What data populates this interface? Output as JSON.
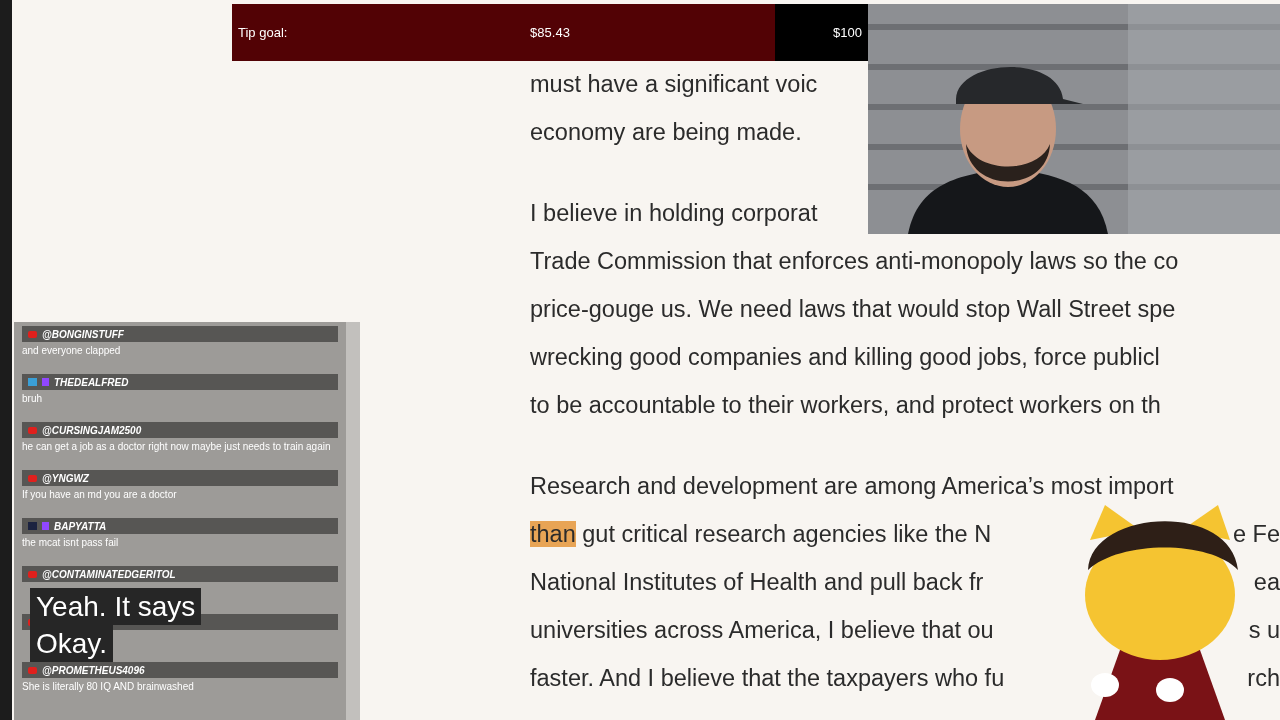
{
  "tip_goal": {
    "label": "Tip goal:",
    "current": "$85.43",
    "target": "$100",
    "level": 0.8543
  },
  "article": {
    "paragraphs": [
      {
        "lines": [
          {
            "text": "must have a significant voic"
          },
          {
            "text": "economy are being made."
          }
        ]
      },
      {
        "lines": [
          {
            "text": "I believe in holding corporat"
          },
          {
            "text": "Trade Commission that enforces anti-monopoly laws so the co"
          },
          {
            "text": "price-gouge us. We need laws that would stop Wall Street spe"
          },
          {
            "text": "wrecking good companies and killing good jobs, force publicl"
          },
          {
            "text": "to be accountable to their workers, and protect workers on th"
          }
        ]
      },
      {
        "lines": [
          {
            "text": "Research and development are among America’s most import"
          },
          {
            "highlight": "than",
            "text": " gut critical research agencies like the N",
            "tail": "e Fe"
          },
          {
            "text": "National Institutes of Health and pull back fr",
            "tail": "ea"
          },
          {
            "text": "universities across America, I believe that ou",
            "tail": "s u"
          },
          {
            "text": "faster. And I believe that the taxpayers who fu",
            "tail": "rch"
          }
        ]
      }
    ]
  },
  "chat": {
    "messages": [
      {
        "kind": "youtube",
        "username": "@BONGINSTUFF",
        "parts": [
          "and everyone clapped"
        ]
      },
      {
        "kind": "twitch",
        "color": "#3a9fd6",
        "username": "THEDEALFRED",
        "parts": [
          "bruh"
        ]
      },
      {
        "kind": "youtube",
        "username": "@CURSINGJAM2500",
        "parts": [
          "he can get a job as a doctor right now maybe just needs to train again"
        ]
      },
      {
        "kind": "youtube",
        "username": "@YNGWZ",
        "parts": [
          "If you have an md you are a doctor"
        ]
      },
      {
        "kind": "twitch",
        "color": "#1c2340",
        "username": "BAPYATTA",
        "parts": [
          "the mcat isnt pass fail"
        ]
      },
      {
        "kind": "youtube",
        "username": "@CONTAMINATEDGERITOL"
      },
      {
        "kind": "youtube"
      },
      {
        "kind": "youtube",
        "username": "@PROMETHEUS4096",
        "parts": [
          "She is literally 80 IQ AND brainwashed"
        ]
      }
    ]
  },
  "captions": [
    "Yeah. It says",
    "Okay."
  ]
}
